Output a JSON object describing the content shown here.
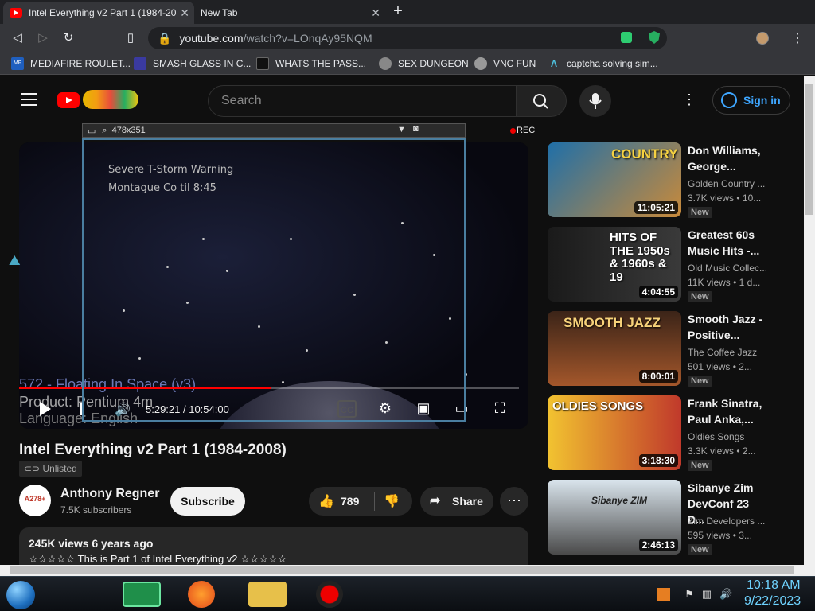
{
  "browser": {
    "tabs": [
      {
        "title": "Intel Everything v2 Part 1 (1984-20",
        "active": true
      },
      {
        "title": "New Tab",
        "active": false
      }
    ],
    "newtab_symbol": "+",
    "url_domain": "youtube.com",
    "url_path": "/watch?v=LOnqAy95NQM",
    "bookmarks": [
      {
        "label": "MEDIAFIRE ROULET...",
        "icon": "mediafire-icon",
        "icon_text": "MF"
      },
      {
        "label": "SMASH GLASS IN C...",
        "icon": "smash-icon"
      },
      {
        "label": "WHATS THE PASS...",
        "icon": "question-icon"
      },
      {
        "label": "SEX DUNGEON",
        "icon": "vr-icon"
      },
      {
        "label": "VNC FUN",
        "icon": "vnc-icon"
      },
      {
        "label": "captcha solving sim...",
        "icon": "captcha-icon"
      }
    ]
  },
  "header": {
    "search_placeholder": "Search",
    "signin_label": "Sign in",
    "more_symbol": "⋮"
  },
  "player": {
    "warning_line1": "Severe T-Storm Warning",
    "warning_line2": "Montague Co til 8:45",
    "overlay_line1": "572 - Floating In Space (v3)",
    "overlay_line2": "Product: Pentium 4m",
    "overlay_line3": "Language: English",
    "time_display": "5:29:21 / 10:54:00",
    "progress_fraction": 0.5047,
    "recorder": {
      "size_label": "478x351",
      "rec_label": "REC"
    }
  },
  "video": {
    "title": "Intel Everything v2 Part 1 (1984-2008)",
    "visibility": "Unlisted",
    "channel_name": "Anthony Regner",
    "channel_subs": "7.5K subscribers",
    "channel_avatar_text": "A278+",
    "subscribe_label": "Subscribe",
    "like_count": "789",
    "share_label": "Share",
    "views_date": "245K views  6 years ago",
    "description": "☆☆☆☆☆ This is Part 1 of Intel Everything v2 ☆☆☆☆☆"
  },
  "recommendations": [
    {
      "title": "Don Williams, George...",
      "channel": "Golden Country ...",
      "stats": "3.7K views  • 10...",
      "duration": "11:05:21",
      "badge": "New",
      "thumb_text": "COUNTRY",
      "thumb_color": "#1f6fa8"
    },
    {
      "title": "Greatest 60s Music Hits -...",
      "channel": "Old Music Collec...",
      "stats": "11K views  • 1 d...",
      "duration": "4:04:55",
      "badge": "New",
      "thumb_text": "HITS OF THE 1950s & 1960s & 19",
      "thumb_color": "#2a2a2a"
    },
    {
      "title": "Smooth Jazz - Positive...",
      "channel": "The Coffee Jazz",
      "stats": "501 views  • 2...",
      "duration": "8:00:01",
      "badge": "New",
      "thumb_text": "SMOOTH JAZZ",
      "thumb_color": "#6b3a1e"
    },
    {
      "title": "Frank Sinatra, Paul Anka,...",
      "channel": "Oldies Songs",
      "stats": "3.3K views  • 2...",
      "duration": "3:18:30",
      "badge": "New",
      "thumb_text": "OLDIES SONGS",
      "thumb_color": "#e6b422"
    },
    {
      "title": "Sibanye Zim DevConf 23 D...",
      "channel": "Zim Developers ...",
      "stats": "595 views  • 3...",
      "duration": "2:46:13",
      "badge": "New",
      "thumb_text": "Sibanye ZIM",
      "thumb_color": "#8aa0b8"
    }
  ],
  "taskbar": {
    "time": "10:18 AM",
    "date": "9/22/2023"
  }
}
